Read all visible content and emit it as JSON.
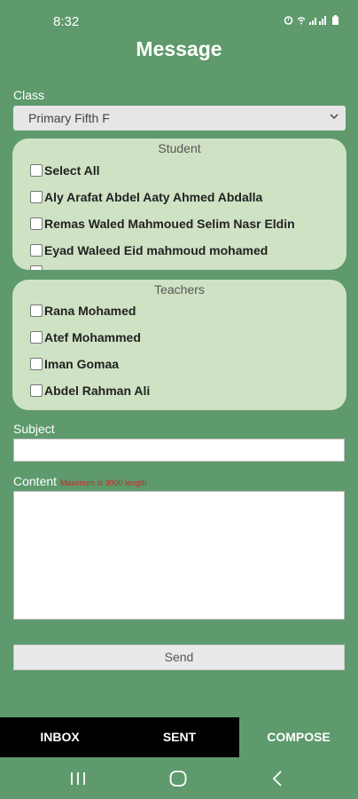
{
  "status_bar": {
    "time": "8:32"
  },
  "header": {
    "title": "Message"
  },
  "class_section": {
    "label": "Class",
    "selected": "Primary Fifth F"
  },
  "students": {
    "title": "Student",
    "items": [
      {
        "label": "Select All",
        "checked": false
      },
      {
        "label": "Aly Arafat Abdel Aaty Ahmed Abdalla",
        "checked": false
      },
      {
        "label": "Remas Waled Mahmoued Selim Nasr Eldin",
        "checked": false
      },
      {
        "label": "Eyad Waleed Eid mahmoud mohamed",
        "checked": false
      }
    ]
  },
  "teachers": {
    "title": "Teachers",
    "items": [
      {
        "label": "Rana Mohamed",
        "checked": false
      },
      {
        "label": "Atef Mohammed",
        "checked": false
      },
      {
        "label": "Iman Gomaa",
        "checked": false
      },
      {
        "label": "Abdel Rahman Ali",
        "checked": false
      }
    ]
  },
  "subject": {
    "label": "Subject",
    "value": ""
  },
  "content": {
    "label": "Content",
    "hint": "Maximum is 3000 length",
    "value": ""
  },
  "send_button": {
    "label": "Send"
  },
  "tabs": [
    {
      "label": "INBOX",
      "active": false
    },
    {
      "label": "SENT",
      "active": false
    },
    {
      "label": "COMPOSE",
      "active": true
    }
  ],
  "colors": {
    "background": "#5e9a6c",
    "panel": "#cfe2c4",
    "tab_inactive": "#000000",
    "hint": "#c62828"
  },
  "icons": [
    "alarm-icon",
    "wifi-icon",
    "signal-icon",
    "battery-icon",
    "chevron-down-icon",
    "recents-icon",
    "home-icon",
    "back-icon"
  ]
}
